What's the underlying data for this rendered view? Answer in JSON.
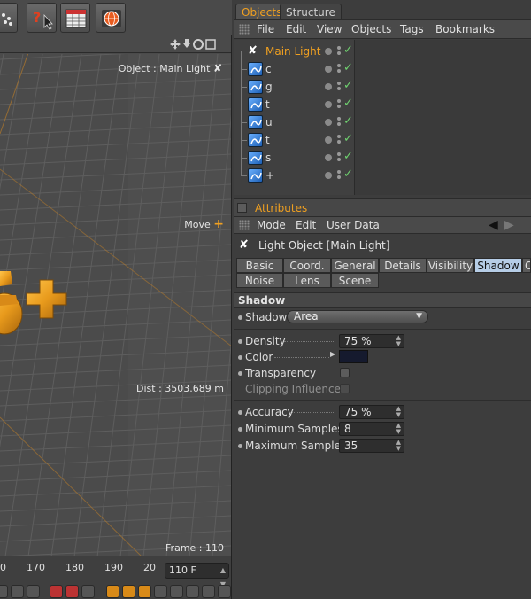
{
  "toolbar": {
    "buttons": [
      {
        "icon": "scatter-icon"
      },
      {
        "icon": "help-cursor-icon"
      },
      {
        "icon": "render-settings-icon"
      },
      {
        "icon": "globe-render-icon"
      }
    ]
  },
  "viewport": {
    "nav_icons": [
      "move-view-icon",
      "dolly-view-icon",
      "rotate-view-icon",
      "maximize-view-icon"
    ],
    "object_label": "Object : Main Light",
    "move_label": "Move",
    "dist_label": "Dist : 3503.689 m",
    "frame_label": "Frame : 110",
    "ruler_ticks": [
      "0",
      "170",
      "180",
      "190",
      "20"
    ],
    "frame_field": "110 F"
  },
  "object_manager": {
    "tabs": [
      {
        "label": "Objects",
        "active": true
      },
      {
        "label": "Structure",
        "active": false
      }
    ],
    "menu": [
      "File",
      "Edit",
      "View",
      "Objects",
      "Tags",
      "Bookmarks"
    ],
    "rows": [
      {
        "name": "Main Light",
        "selected": true,
        "icon": "light-icon"
      },
      {
        "name": "c",
        "icon": "text-spline-icon"
      },
      {
        "name": "g",
        "icon": "text-spline-icon"
      },
      {
        "name": "t",
        "icon": "text-spline-icon"
      },
      {
        "name": "u",
        "icon": "text-spline-icon"
      },
      {
        "name": "t",
        "icon": "text-spline-icon"
      },
      {
        "name": "s",
        "icon": "text-spline-icon"
      },
      {
        "name": "+",
        "icon": "text-spline-icon"
      }
    ]
  },
  "attributes": {
    "title": "Attributes",
    "menu": [
      "Mode",
      "Edit",
      "User Data"
    ],
    "object_title": "Light Object [Main Light]",
    "tabs_row1": [
      "Basic",
      "Coord.",
      "General",
      "Details",
      "Visibility",
      "Shadow",
      "C"
    ],
    "tabs_row2": [
      "Noise",
      "Lens",
      "Scene"
    ],
    "active_tab": "Shadow",
    "section": "Shadow",
    "shadow_label": "Shadow",
    "shadow_value": "Area",
    "density_label": "Density",
    "density_value": "75 %",
    "color_label": "Color",
    "color_value": "#151a2e",
    "transparency_label": "Transparency",
    "clipping_label": "Clipping Influence",
    "accuracy_label": "Accuracy",
    "accuracy_value": "75 %",
    "min_samples_label": "Minimum Samples",
    "min_samples_value": "8",
    "max_samples_label": "Maximum Samples",
    "max_samples_value": "35"
  },
  "colors": {
    "accent": "#f0a020",
    "active_tab": "#b6cde6",
    "viewport_bg": "#4b4b4b"
  }
}
